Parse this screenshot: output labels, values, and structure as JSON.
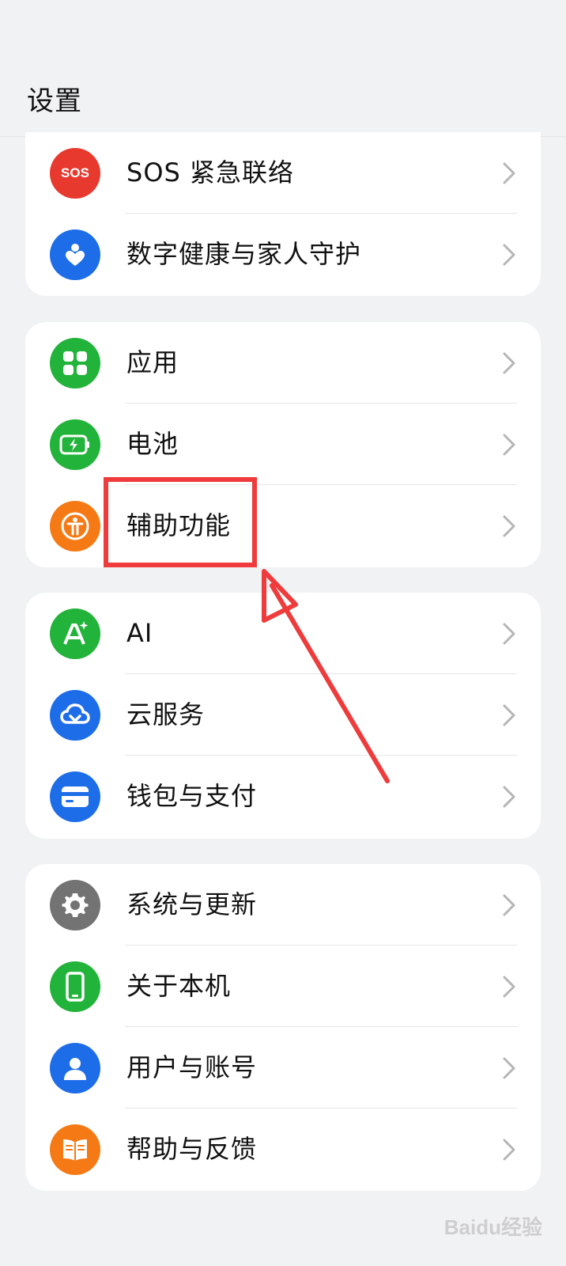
{
  "header": {
    "title": "设置"
  },
  "cards": {
    "sos_group": {
      "items": [
        {
          "label": "SOS 紧急联络",
          "icon_text": "SOS",
          "icon": "sos-icon",
          "color": "#e8392f"
        },
        {
          "label": "数字健康与家人守护",
          "icon": "heart-person-icon",
          "color": "#1e6de8"
        }
      ]
    },
    "apps_group": {
      "items": [
        {
          "label": "应用",
          "icon": "apps-grid-icon",
          "color": "#22b33a"
        },
        {
          "label": "电池",
          "icon": "battery-icon",
          "color": "#22b33a"
        },
        {
          "label": "辅助功能",
          "icon": "accessibility-icon",
          "color": "#f57a15"
        }
      ]
    },
    "services_group": {
      "items": [
        {
          "label": "AI",
          "icon": "ai-icon",
          "color": "#22b33a"
        },
        {
          "label": "云服务",
          "icon": "cloud-icon",
          "color": "#1e6de8"
        },
        {
          "label": "钱包与支付",
          "icon": "wallet-icon",
          "color": "#1e6de8"
        }
      ]
    },
    "system_group": {
      "items": [
        {
          "label": "系统与更新",
          "icon": "gear-icon",
          "color": "#737373"
        },
        {
          "label": "关于本机",
          "icon": "phone-icon",
          "color": "#22b33a"
        },
        {
          "label": "用户与账号",
          "icon": "user-icon",
          "color": "#1e6de8"
        },
        {
          "label": "帮助与反馈",
          "icon": "book-icon",
          "color": "#f57a15"
        }
      ]
    }
  },
  "annotation": {
    "color": "#ef3b3b"
  },
  "watermark": {
    "text": "Baidu经验"
  }
}
